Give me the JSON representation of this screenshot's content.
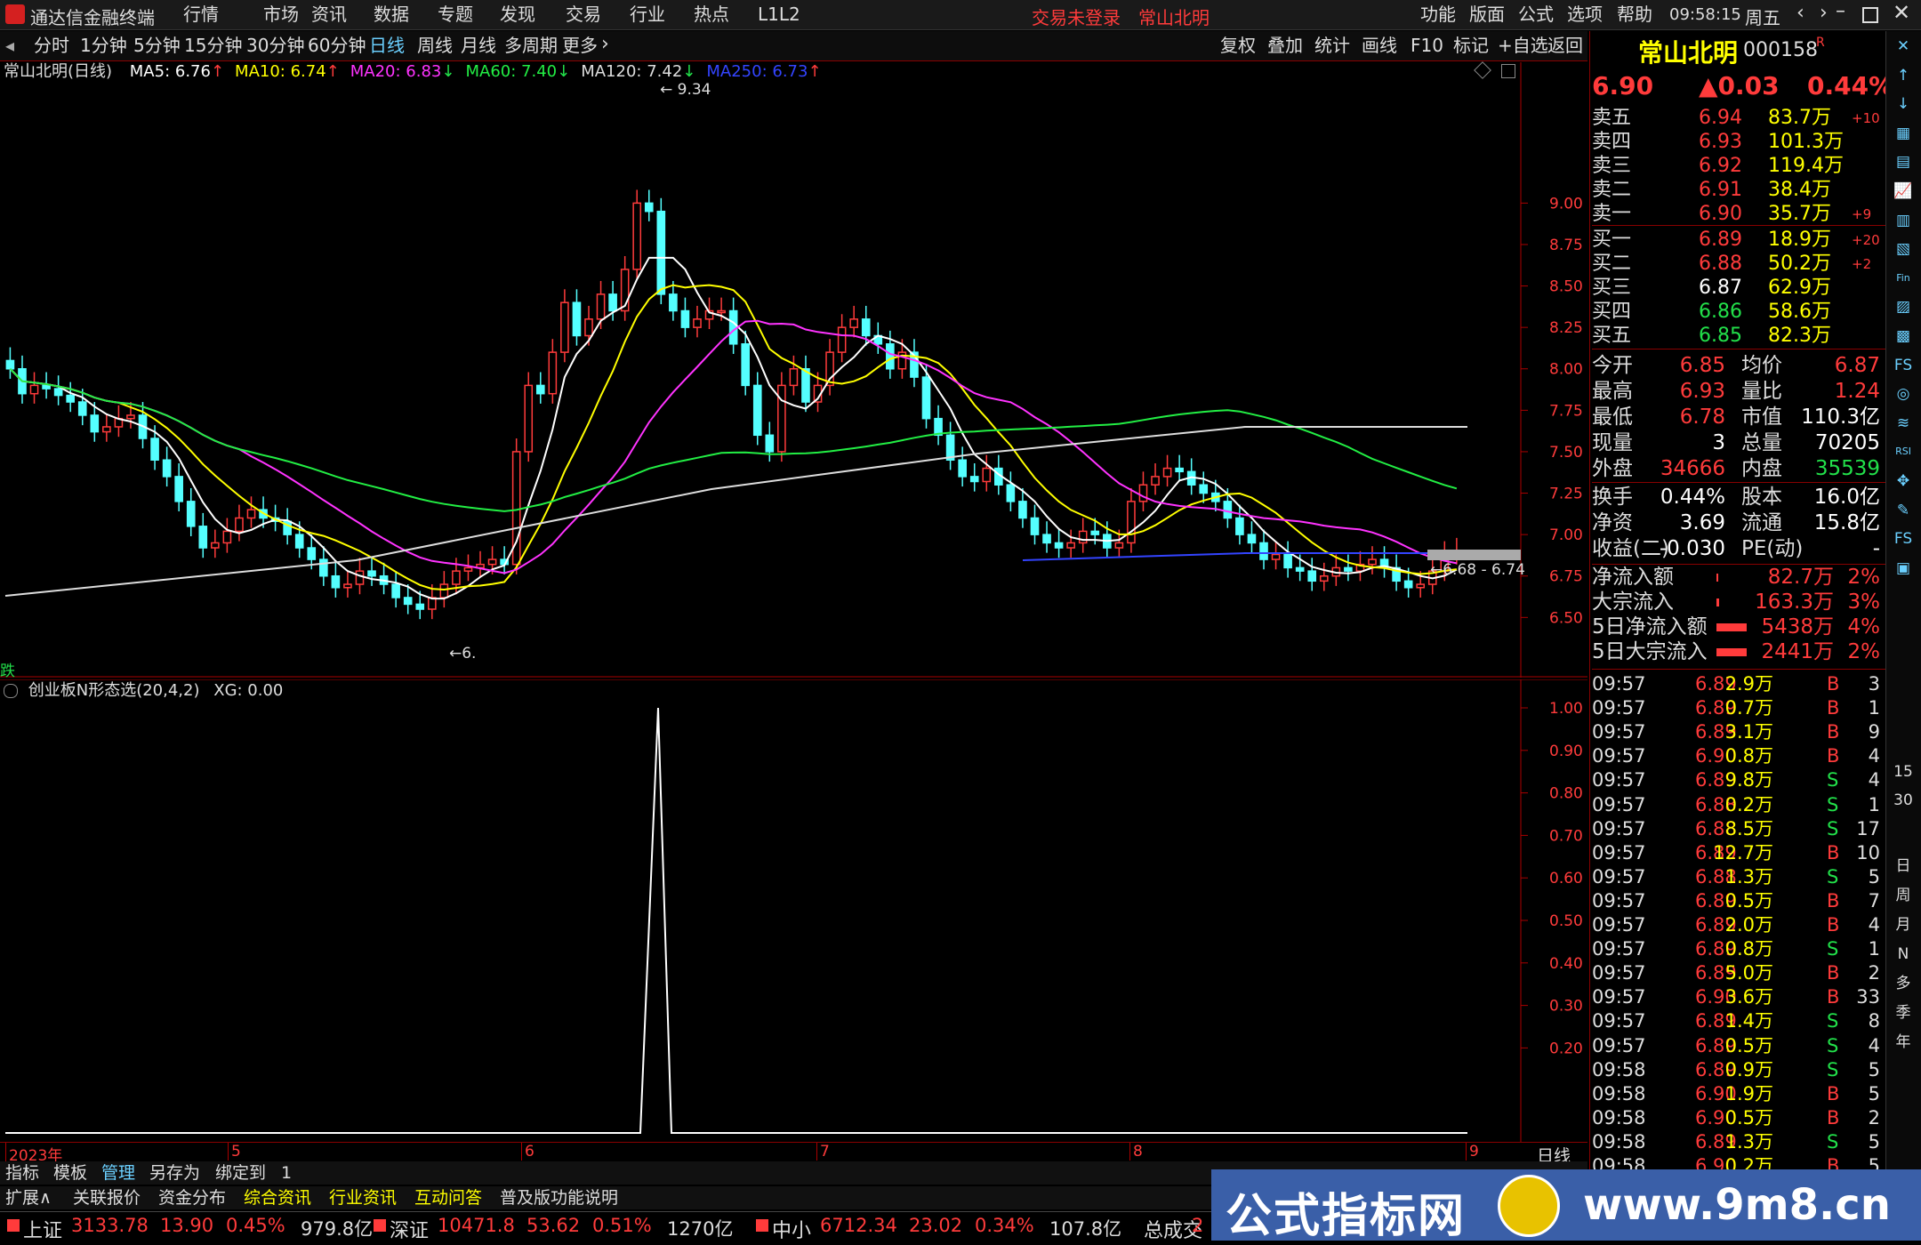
{
  "titlebar": {
    "app_title": "通达信金融终端",
    "menus": [
      "行情",
      "市场",
      "资讯",
      "数据",
      "专题",
      "发现",
      "交易",
      "行业",
      "热点",
      "L1L2"
    ],
    "login_status": "交易未登录",
    "stock_name": "常山北明",
    "right_menus": [
      "功能",
      "版面",
      "公式",
      "选项",
      "帮助"
    ],
    "time": "09:58:15",
    "weekday": "周五"
  },
  "periodbar": {
    "periods": [
      "分时",
      "1分钟",
      "5分钟",
      "15分钟",
      "30分钟",
      "60分钟",
      "日线",
      "周线",
      "月线",
      "多周期",
      "更多"
    ],
    "active": "日线",
    "tools": [
      "复权",
      "叠加",
      "统计",
      "画线",
      "F10",
      "标记",
      "+自选",
      "返回"
    ]
  },
  "ma_legend": {
    "title": "常山北明(日线)",
    "items": [
      {
        "label": "MA5: 6.76",
        "arrow": "↑",
        "color": "#ffffff"
      },
      {
        "label": "MA10: 6.74",
        "arrow": "↑",
        "color": "#ffff00"
      },
      {
        "label": "MA20: 6.83",
        "arrow": "↓",
        "color": "#ff33ff"
      },
      {
        "label": "MA60: 7.40",
        "arrow": "↓",
        "color": "#22ee44"
      },
      {
        "label": "MA120: 7.42",
        "arrow": "↓",
        "color": "#dddddd"
      },
      {
        "label": "MA250: 6.73",
        "arrow": "↑",
        "color": "#3344ff"
      }
    ]
  },
  "main_chart": {
    "y_ticks": [
      "9.00",
      "8.75",
      "8.50",
      "8.25",
      "8.00",
      "7.75",
      "7.50",
      "7.25",
      "7.00",
      "6.75",
      "6.50"
    ],
    "high_label": "9.34",
    "low_label": "6.",
    "range_label": "6.68 - 6.74",
    "corner_label": "跌"
  },
  "indicator": {
    "title": "创业板N形态选(20,4,2)",
    "value_label": "XG: 0.00",
    "y_ticks": [
      "1.00",
      "0.90",
      "0.80",
      "0.70",
      "0.60",
      "0.50",
      "0.40",
      "0.30",
      "0.20"
    ]
  },
  "time_axis": {
    "labels": [
      "2023年",
      "5",
      "6",
      "7",
      "8",
      "9"
    ],
    "period_label": "日线"
  },
  "quote": {
    "name": "常山北明",
    "code": "000158",
    "badge": "R",
    "price": "6.90",
    "change": "▲0.03",
    "pct": "0.44%",
    "asks": [
      {
        "label": "卖五",
        "price": "6.94",
        "vol": "83.7万",
        "delta": "+10"
      },
      {
        "label": "卖四",
        "price": "6.93",
        "vol": "101.3万",
        "delta": ""
      },
      {
        "label": "卖三",
        "price": "6.92",
        "vol": "119.4万",
        "delta": ""
      },
      {
        "label": "卖二",
        "price": "6.91",
        "vol": "38.4万",
        "delta": ""
      },
      {
        "label": "卖一",
        "price": "6.90",
        "vol": "35.7万",
        "delta": "+9"
      }
    ],
    "bids": [
      {
        "label": "买一",
        "price": "6.89",
        "vol": "18.9万",
        "delta": "+20"
      },
      {
        "label": "买二",
        "price": "6.88",
        "vol": "50.2万",
        "delta": "+2"
      },
      {
        "label": "买三",
        "price": "6.87",
        "vol": "62.9万",
        "delta": ""
      },
      {
        "label": "买四",
        "price": "6.86",
        "vol": "58.6万",
        "delta": ""
      },
      {
        "label": "买五",
        "price": "6.85",
        "vol": "82.3万",
        "delta": ""
      }
    ],
    "stats": [
      [
        "今开",
        "6.85",
        "均价",
        "6.87"
      ],
      [
        "最高",
        "6.93",
        "量比",
        "1.24"
      ],
      [
        "最低",
        "6.78",
        "市值",
        "110.3亿"
      ],
      [
        "现量",
        "3",
        "总量",
        "70205"
      ],
      [
        "外盘",
        "34666",
        "内盘",
        "35539"
      ]
    ],
    "stats2": [
      [
        "换手",
        "0.44%",
        "股本",
        "16.0亿"
      ],
      [
        "净资",
        "3.69",
        "流通",
        "15.8亿"
      ],
      [
        "收益(二)",
        "-0.030",
        "PE(动)",
        "-"
      ]
    ],
    "flows": [
      [
        "净流入额",
        "82.7万",
        "2%"
      ],
      [
        "大宗流入",
        "163.3万",
        "3%"
      ],
      [
        "5日净流入额",
        "5438万",
        "4%"
      ],
      [
        "5日大宗流入",
        "2441万",
        "2%"
      ]
    ]
  },
  "ticks": [
    [
      "09:57",
      "6.89",
      "2.9万",
      "B",
      "3"
    ],
    [
      "09:57",
      "6.89",
      "0.7万",
      "B",
      "1"
    ],
    [
      "09:57",
      "6.89",
      "3.1万",
      "B",
      "9"
    ],
    [
      "09:57",
      "6.90",
      "0.8万",
      "B",
      "4"
    ],
    [
      "09:57",
      "6.89",
      "9.8万",
      "S",
      "4"
    ],
    [
      "09:57",
      "6.88",
      "0.2万",
      "S",
      "1"
    ],
    [
      "09:57",
      "6.88",
      "8.5万",
      "S",
      "17"
    ],
    [
      "09:57",
      "6.89",
      "12.7万",
      "B",
      "10"
    ],
    [
      "09:57",
      "6.88",
      "1.3万",
      "S",
      "5"
    ],
    [
      "09:57",
      "6.89",
      "0.5万",
      "B",
      "7"
    ],
    [
      "09:57",
      "6.89",
      "2.0万",
      "B",
      "4"
    ],
    [
      "09:57",
      "6.89",
      "0.8万",
      "S",
      "1"
    ],
    [
      "09:57",
      "6.89",
      "5.0万",
      "B",
      "2"
    ],
    [
      "09:57",
      "6.90",
      "3.6万",
      "B",
      "33"
    ],
    [
      "09:57",
      "6.89",
      "1.4万",
      "S",
      "8"
    ],
    [
      "09:57",
      "6.89",
      "0.5万",
      "S",
      "4"
    ],
    [
      "09:58",
      "6.89",
      "0.9万",
      "S",
      "5"
    ],
    [
      "09:58",
      "6.90",
      "1.9万",
      "B",
      "5"
    ],
    [
      "09:58",
      "6.90",
      "0.5万",
      "B",
      "2"
    ],
    [
      "09:58",
      "6.89",
      "1.3万",
      "S",
      "5"
    ],
    [
      "09:58",
      "6.90",
      "0.2万",
      "B",
      "5"
    ]
  ],
  "sidebar_icons": [
    "日",
    "周",
    "月",
    "N",
    "多",
    "季",
    "年"
  ],
  "sidebar_nums": [
    "15",
    "30"
  ],
  "bottom_tabs1": [
    "指标",
    "模板",
    "管理",
    "另存为",
    "绑定到",
    "1"
  ],
  "bottom_tabs2": [
    "扩展∧",
    "关联报价",
    "资金分布",
    "综合资讯",
    "行业资讯",
    "互动问答",
    "普及版功能说明"
  ],
  "index_bar": [
    {
      "name": "上证",
      "value": "3133.78",
      "chg": "13.90",
      "pct": "0.45%",
      "amt": "979.8亿"
    },
    {
      "name": "深证",
      "value": "10471.8",
      "chg": "53.62",
      "pct": "0.51%",
      "amt": "1270亿"
    },
    {
      "name": "中小",
      "value": "6712.34",
      "chg": "23.02",
      "pct": "0.34%",
      "amt": "107.8亿"
    },
    {
      "name": "总成交",
      "value": "2"
    }
  ],
  "watermark": {
    "text1": "公式指标网",
    "text2": "www.9m8.cn"
  }
}
